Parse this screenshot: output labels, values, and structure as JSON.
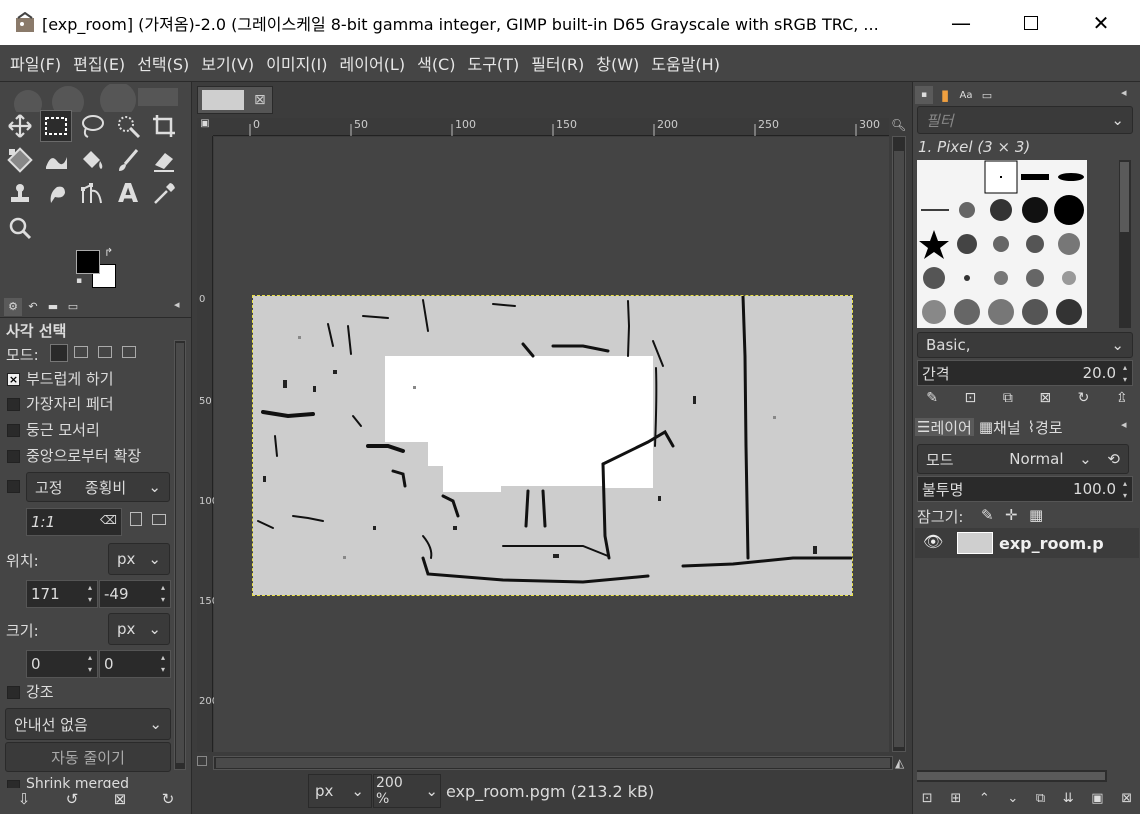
{
  "window": {
    "title": "[exp_room] (가져옴)-2.0 (그레이스케일 8-bit gamma integer, GIMP built-in D65 Grayscale with sRGB TRC, ...",
    "minimize_icon": "minimize-icon",
    "maximize_icon": "maximize-icon",
    "close_icon": "close-icon"
  },
  "menu": [
    "파일(F)",
    "편집(E)",
    "선택(S)",
    "보기(V)",
    "이미지(I)",
    "레이어(L)",
    "색(C)",
    "도구(T)",
    "필터(R)",
    "창(W)",
    "도움말(H)"
  ],
  "toolbox": {
    "tools": [
      "move-tool",
      "rect-select-tool",
      "lasso-tool",
      "fuzzy-select-tool",
      "crop-tool",
      "unified-transform-tool",
      "warp-tool",
      "bucket-fill-tool",
      "paintbrush-tool",
      "eraser-tool",
      "clone-tool",
      "smudge-tool",
      "paths-tool",
      "text-tool",
      "color-picker-tool",
      "zoom-tool"
    ],
    "active_tool": "rect-select-tool",
    "fg_color": "#000000",
    "bg_color": "#ffffff"
  },
  "tool_options": {
    "title": "사각 선택",
    "mode_label": "모드:",
    "antialias": {
      "label": "부드럽게 하기",
      "checked": true
    },
    "feather": {
      "label": "가장자리 페더",
      "checked": false
    },
    "rounded": {
      "label": "둥근 모서리",
      "checked": false
    },
    "expand_center": {
      "label": "중앙으로부터 확장",
      "checked": false
    },
    "fixed_label": "고정",
    "fixed_value": "종횡비",
    "ratio_value": "1:1",
    "position_label": "위치:",
    "position_unit": "px",
    "pos_x": "171",
    "pos_y": "-49",
    "size_label": "크기:",
    "size_unit": "px",
    "size_w": "0",
    "size_h": "0",
    "highlight": {
      "label": "강조",
      "checked": false
    },
    "guides_value": "안내선 없음",
    "autoshrink_label": "자동 줄이기",
    "shrink_merged_label": "Shrink merged"
  },
  "canvas": {
    "ruler_top_labels": [
      "0",
      "50",
      "100",
      "150",
      "200",
      "250",
      "300"
    ],
    "ruler_left_labels": [
      "0",
      "50",
      "100",
      "150",
      "200"
    ],
    "status_unit": "px",
    "zoom": "200 %",
    "file_info": "exp_room.pgm (213.2 kB)"
  },
  "brushes": {
    "filter_placeholder": "필터",
    "current_brush": "1. Pixel (3 × 3)",
    "preset": "Basic,",
    "spacing_label": "간격",
    "spacing_value": "20.0"
  },
  "layers": {
    "tabs": [
      "레이어",
      "채널",
      "경로"
    ],
    "mode_label": "모드",
    "mode_value": "Normal",
    "opacity_label": "불투명",
    "opacity_value": "100.0",
    "lock_label": "잠그기:",
    "layer_name": "exp_room.p"
  }
}
